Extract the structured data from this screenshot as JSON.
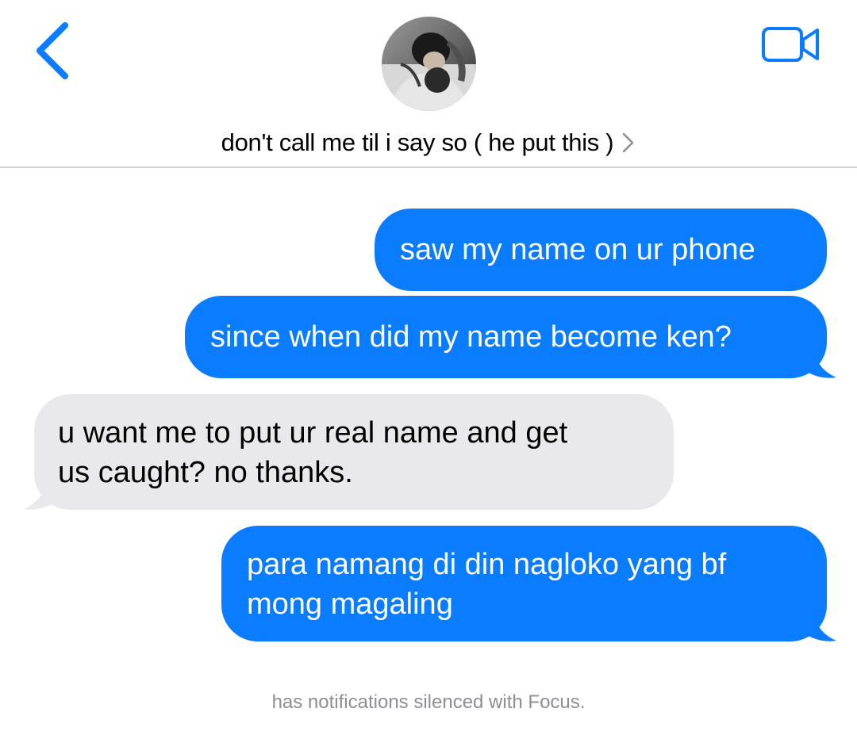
{
  "header": {
    "back_icon": "chevron-left-icon",
    "video_icon": "video-camera-icon",
    "contact_name": "don't call me til i say so ( he put this )",
    "accent_color": "#0a7cff"
  },
  "messages": [
    {
      "direction": "sent",
      "text": "saw my name on ur phone"
    },
    {
      "direction": "sent",
      "text": "since when did my name become ken?"
    },
    {
      "direction": "received",
      "text": "u want me to put ur real name and get\nus caught? no thanks."
    },
    {
      "direction": "sent",
      "text": "para namang di din nagloko yang bf\nmong magaling"
    }
  ],
  "footer": {
    "status": "has notifications silenced with Focus."
  },
  "colors": {
    "sent_bubble": "#0a7cff",
    "received_bubble": "#e9e9eb",
    "divider": "#d1d1d6",
    "secondary_text": "#8e8e93"
  }
}
